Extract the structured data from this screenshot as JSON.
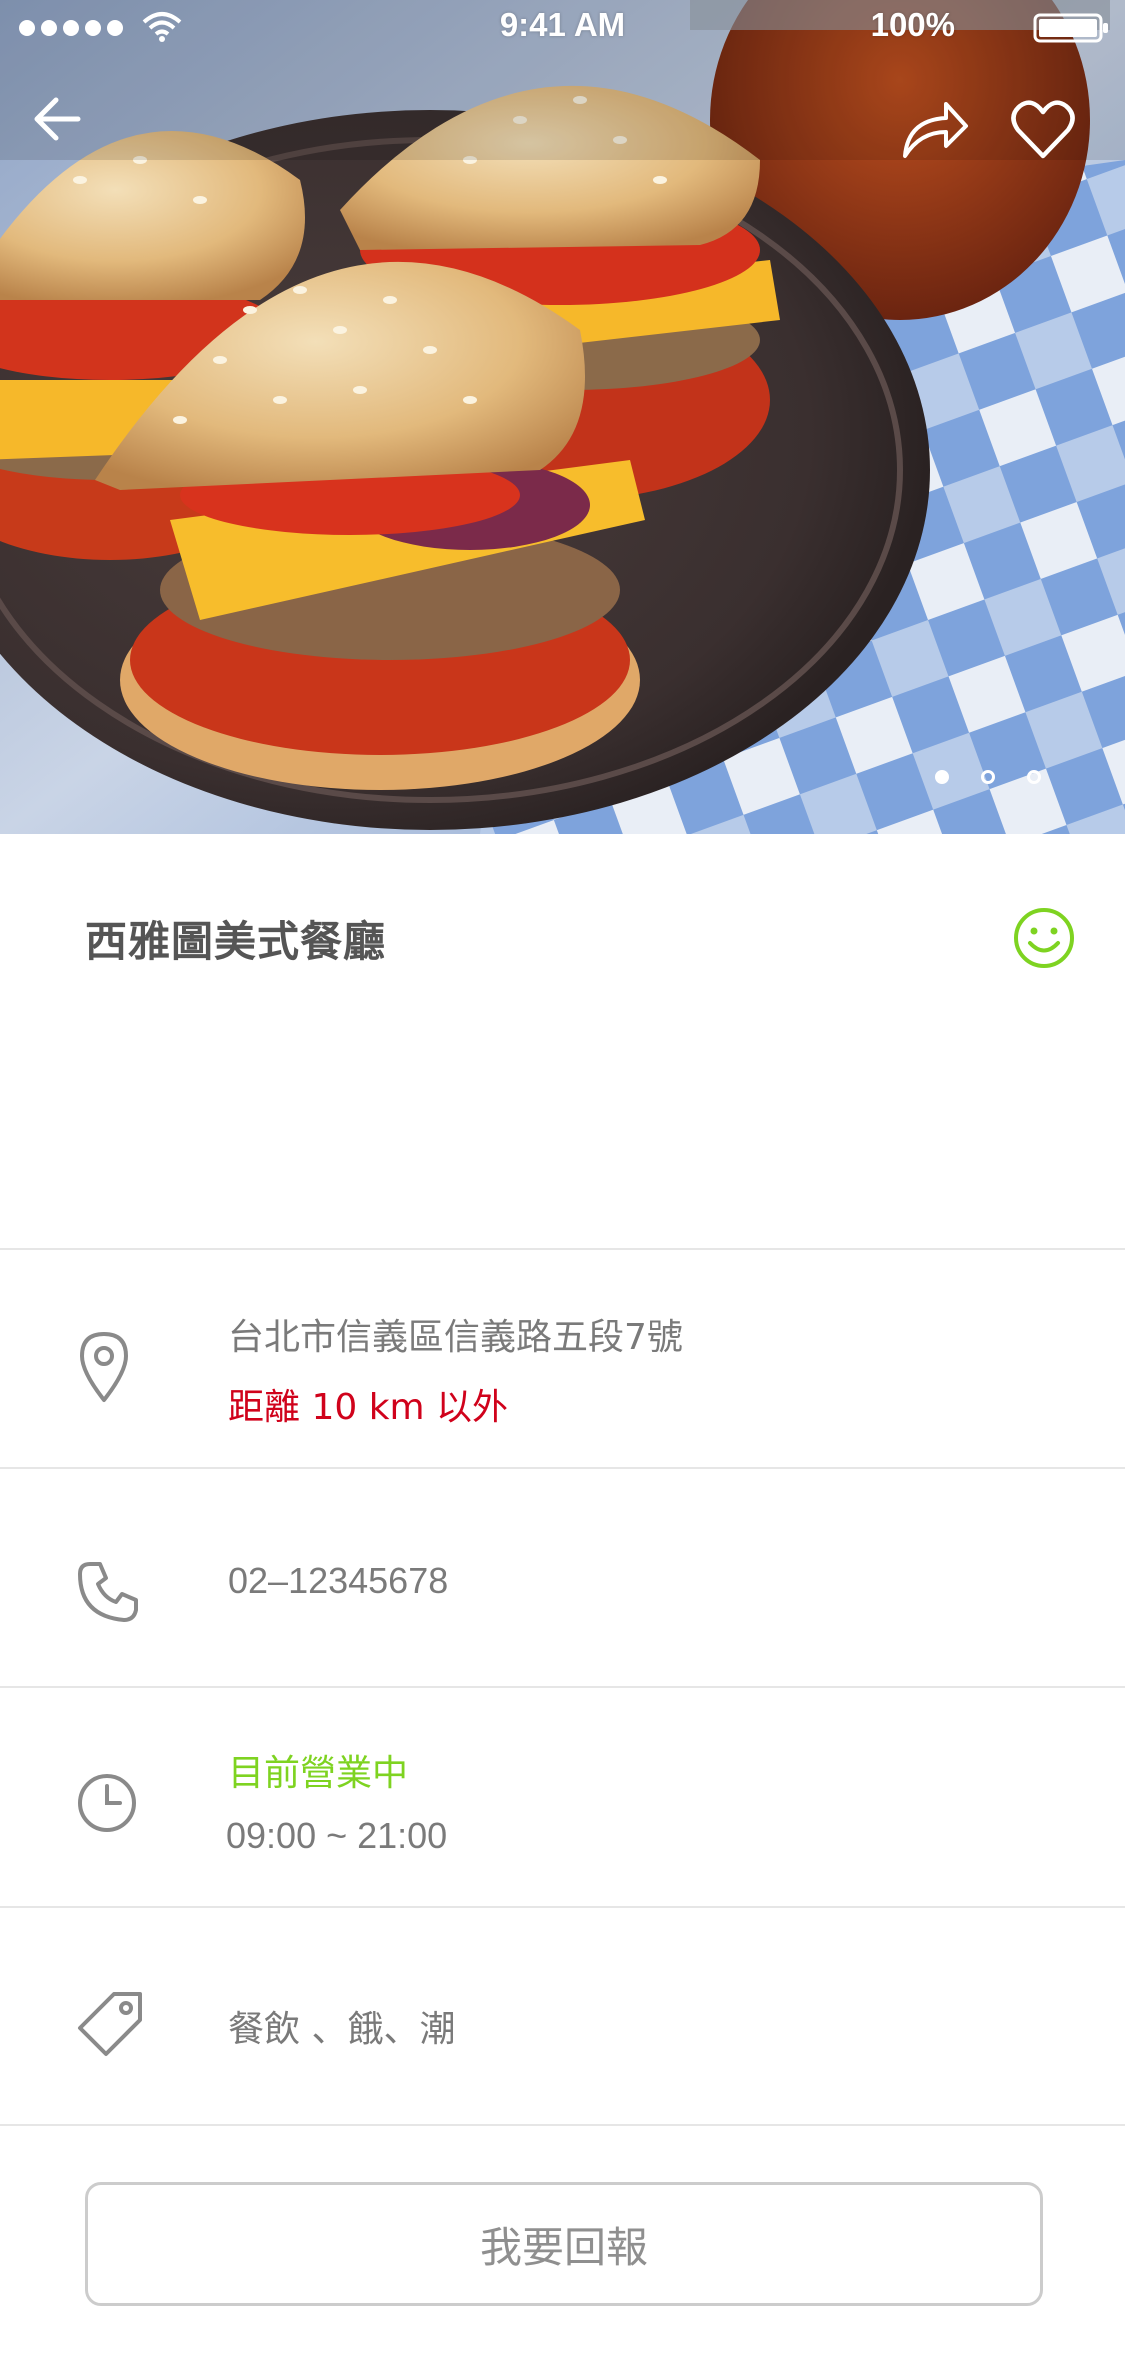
{
  "status_bar": {
    "time": "9:41 AM",
    "battery": "100%"
  },
  "hero": {
    "image": "burger-sliders-photo",
    "carousel": {
      "total": 3,
      "active": 1
    }
  },
  "nav": {
    "back_icon": "arrow-left-icon",
    "share_icon": "share-arrow-icon",
    "favorite_icon": "heart-icon"
  },
  "store": {
    "name": "西雅圖美式餐廳",
    "rating_icon": "smiley-icon",
    "address": "台北市信義區信義路五段7號",
    "distance": "距離 10 km 以外",
    "phone": "02–12345678",
    "open_status": "目前營業中",
    "hours": "09:00 ~ 21:00",
    "tags": "餐飲 、餓、潮"
  },
  "actions": {
    "report_label": "我要回報"
  },
  "colors": {
    "accent_green": "#7ed321",
    "alert_red": "#d0021b",
    "text_gray": "#7a7a7a",
    "divider": "#e6e6e6"
  }
}
